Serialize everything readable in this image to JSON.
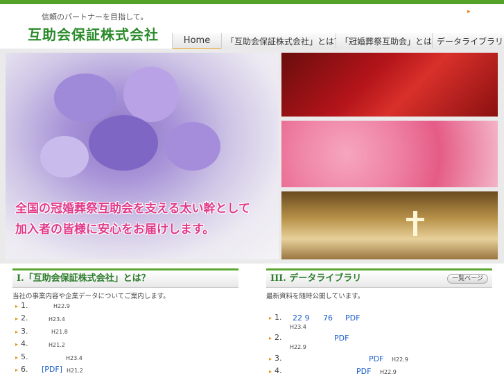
{
  "header": {
    "tagline": "信頼のパートナーを目指して。",
    "logo": "互助会保証株式会社",
    "corner_arrow": "▸"
  },
  "nav": {
    "items": [
      {
        "label": "Home"
      },
      {
        "label": "「互助会保証株式会社」とは？"
      },
      {
        "label": "「冠婚葬祭互助会」とは？"
      },
      {
        "label": "データライブラリ"
      }
    ]
  },
  "hero": {
    "line1": "全国の冠婚葬祭互助会を支える太い幹として",
    "line2": "加入者の皆様に安心をお届けします。"
  },
  "section1": {
    "title": "I.「互助会保証株式会社」とは？",
    "description": "当社の事業内容や企業データについてご案内します。",
    "items": [
      {
        "num": "1.",
        "date": "H22.9"
      },
      {
        "num": "2.",
        "date": "H23.4"
      },
      {
        "num": "3.",
        "date": "H21.8"
      },
      {
        "num": "4.",
        "date": "H21.2"
      },
      {
        "num": "5.",
        "date": "H23.4"
      },
      {
        "num": "6.",
        "link": "[PDF]",
        "date": "H21.2"
      }
    ]
  },
  "section2": {
    "title": "III. データライブラリ",
    "more_button": "一覧ページ",
    "description": "最新資料を随時公開しています。",
    "items": [
      {
        "num": "1.",
        "link_a": "22 9",
        "link_b": "76",
        "pdf": "PDF",
        "date": "H23.4"
      },
      {
        "num": "2.",
        "pdf": "PDF",
        "date": "H22.9"
      },
      {
        "num": "3.",
        "pdf": "PDF",
        "date": "H22.9"
      },
      {
        "num": "4.",
        "pdf": "PDF",
        "date": "H22.9"
      }
    ]
  },
  "colors": {
    "brand_green": "#55a22a",
    "accent_orange": "#e8900c",
    "link_blue": "#1a5ec8",
    "hero_text_pink": "#e03a8a"
  }
}
